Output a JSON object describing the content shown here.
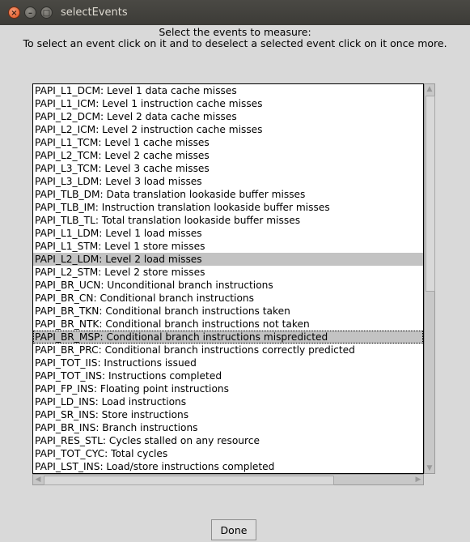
{
  "window": {
    "title": "selectEvents",
    "close_glyph": "×",
    "min_glyph": "–",
    "max_glyph": "□"
  },
  "instructions": {
    "line1": "Select the events to measure:",
    "line2": "To select an event click on it and to deselect a selected event click on it once more."
  },
  "events": [
    {
      "label": "PAPI_L1_DCM: Level 1 data cache misses",
      "state": "normal"
    },
    {
      "label": "PAPI_L1_ICM: Level 1 instruction cache misses",
      "state": "normal"
    },
    {
      "label": "PAPI_L2_DCM: Level 2 data cache misses",
      "state": "normal"
    },
    {
      "label": "PAPI_L2_ICM: Level 2 instruction cache misses",
      "state": "normal"
    },
    {
      "label": "PAPI_L1_TCM: Level 1 cache misses",
      "state": "normal"
    },
    {
      "label": "PAPI_L2_TCM: Level 2 cache misses",
      "state": "normal"
    },
    {
      "label": "PAPI_L3_TCM: Level 3 cache misses",
      "state": "normal"
    },
    {
      "label": "PAPI_L3_LDM: Level 3 load misses",
      "state": "normal"
    },
    {
      "label": "PAPI_TLB_DM: Data translation lookaside buffer misses",
      "state": "normal"
    },
    {
      "label": "PAPI_TLB_IM: Instruction translation lookaside buffer misses",
      "state": "normal"
    },
    {
      "label": "PAPI_TLB_TL: Total translation lookaside buffer misses",
      "state": "normal"
    },
    {
      "label": "PAPI_L1_LDM: Level 1 load misses",
      "state": "normal"
    },
    {
      "label": "PAPI_L1_STM: Level 1 store misses",
      "state": "normal"
    },
    {
      "label": "PAPI_L2_LDM: Level 2 load misses",
      "state": "selected"
    },
    {
      "label": "PAPI_L2_STM: Level 2 store misses",
      "state": "normal"
    },
    {
      "label": "PAPI_BR_UCN: Unconditional branch instructions",
      "state": "normal"
    },
    {
      "label": "PAPI_BR_CN: Conditional branch instructions",
      "state": "normal"
    },
    {
      "label": "PAPI_BR_TKN: Conditional branch instructions taken",
      "state": "normal"
    },
    {
      "label": "PAPI_BR_NTK: Conditional branch instructions not taken",
      "state": "normal"
    },
    {
      "label": "PAPI_BR_MSP: Conditional branch instructions mispredicted",
      "state": "active"
    },
    {
      "label": "PAPI_BR_PRC: Conditional branch instructions correctly predicted",
      "state": "normal"
    },
    {
      "label": "PAPI_TOT_IIS: Instructions issued",
      "state": "normal"
    },
    {
      "label": "PAPI_TOT_INS: Instructions completed",
      "state": "normal"
    },
    {
      "label": "PAPI_FP_INS: Floating point instructions",
      "state": "normal"
    },
    {
      "label": "PAPI_LD_INS: Load instructions",
      "state": "normal"
    },
    {
      "label": "PAPI_SR_INS: Store instructions",
      "state": "normal"
    },
    {
      "label": "PAPI_BR_INS: Branch instructions",
      "state": "normal"
    },
    {
      "label": "PAPI_RES_STL: Cycles stalled on any resource",
      "state": "normal"
    },
    {
      "label": "PAPI_TOT_CYC: Total cycles",
      "state": "normal"
    },
    {
      "label": "PAPI_LST_INS: Load/store instructions completed",
      "state": "normal"
    }
  ],
  "scrollbars": {
    "up_glyph": "▲",
    "down_glyph": "▼",
    "left_glyph": "◀",
    "right_glyph": "▶"
  },
  "buttons": {
    "done_label": "Done"
  },
  "colors": {
    "window_bg": "#d9d9d9",
    "titlebar_bg": "#3c3b37",
    "selected_bg": "#c3c3c3",
    "close_button": "#e0521c"
  }
}
